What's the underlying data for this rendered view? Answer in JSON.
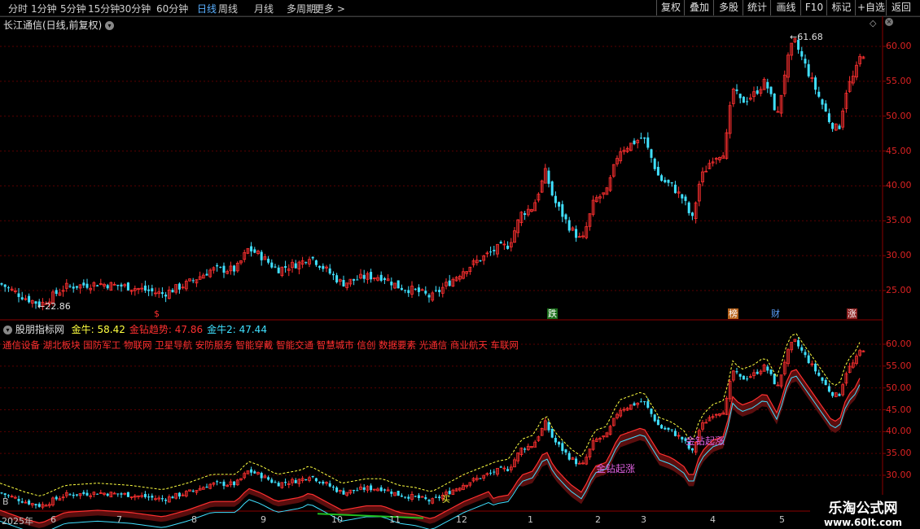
{
  "toolbar": {
    "periods": [
      "分时",
      "1分钟",
      "5分钟",
      "15分钟",
      "30分钟",
      "60分钟",
      "日线",
      "周线",
      "月线",
      "多周期",
      "更多 >"
    ],
    "active_period": "日线",
    "buttons": [
      "复权",
      "叠加",
      "多股",
      "统计",
      "画线",
      "F10",
      "标记",
      "+自选",
      "返回"
    ]
  },
  "main_chart": {
    "title": "长江通信(日线,前复权)",
    "high_label": "61.68",
    "low_label": "22.86",
    "y_ticks": [
      "60.00",
      "55.00",
      "50.00",
      "45.00",
      "40.00",
      "35.00",
      "30.00",
      "25.00"
    ],
    "markers": [
      {
        "text": "$",
        "color": "#ff3030",
        "bg": "transparent"
      },
      {
        "text": "跌",
        "color": "#ffffff",
        "bg": "#1a6e1a"
      },
      {
        "text": "榜",
        "color": "#ffffff",
        "bg": "#b8621a"
      },
      {
        "text": "财",
        "color": "#5aa0ff",
        "bg": "transparent"
      },
      {
        "text": "涨",
        "color": "#ffffff",
        "bg": "#8b2020"
      }
    ]
  },
  "indicator": {
    "name": "股朋指标网",
    "values": [
      {
        "label": "金牛: 58.42",
        "color": "#ffff40"
      },
      {
        "label": "金钻趋势: 47.86",
        "color": "#ff3030"
      },
      {
        "label": "金牛2: 47.44",
        "color": "#40e0ff"
      }
    ],
    "sectors": "通信设备 湖北板块 国防军工 物联网 卫星导航 安防服务 智能穿戴 智能交通 智慧城市 信创 数据要素 光通信 商业航天 车联网",
    "y_ticks": [
      "60.00",
      "55.00",
      "50.00",
      "45.00",
      "40.00",
      "35.00",
      "30.00"
    ],
    "signal_labels": [
      "金钻起涨",
      "金钻起涨"
    ],
    "small_labels": [
      "B",
      "买"
    ]
  },
  "x_axis": {
    "year_label": "2025年",
    "months": [
      "6",
      "7",
      "8",
      "9",
      "10",
      "11",
      "12",
      "1",
      "2",
      "3",
      "4",
      "5"
    ]
  },
  "watermark": {
    "line1": "乐淘公式网",
    "line2": "www.60lt.com"
  },
  "colors": {
    "up": "#ff3030",
    "down": "#40e0ff",
    "grid": "#5a0000",
    "ma": "#ffff40"
  }
}
